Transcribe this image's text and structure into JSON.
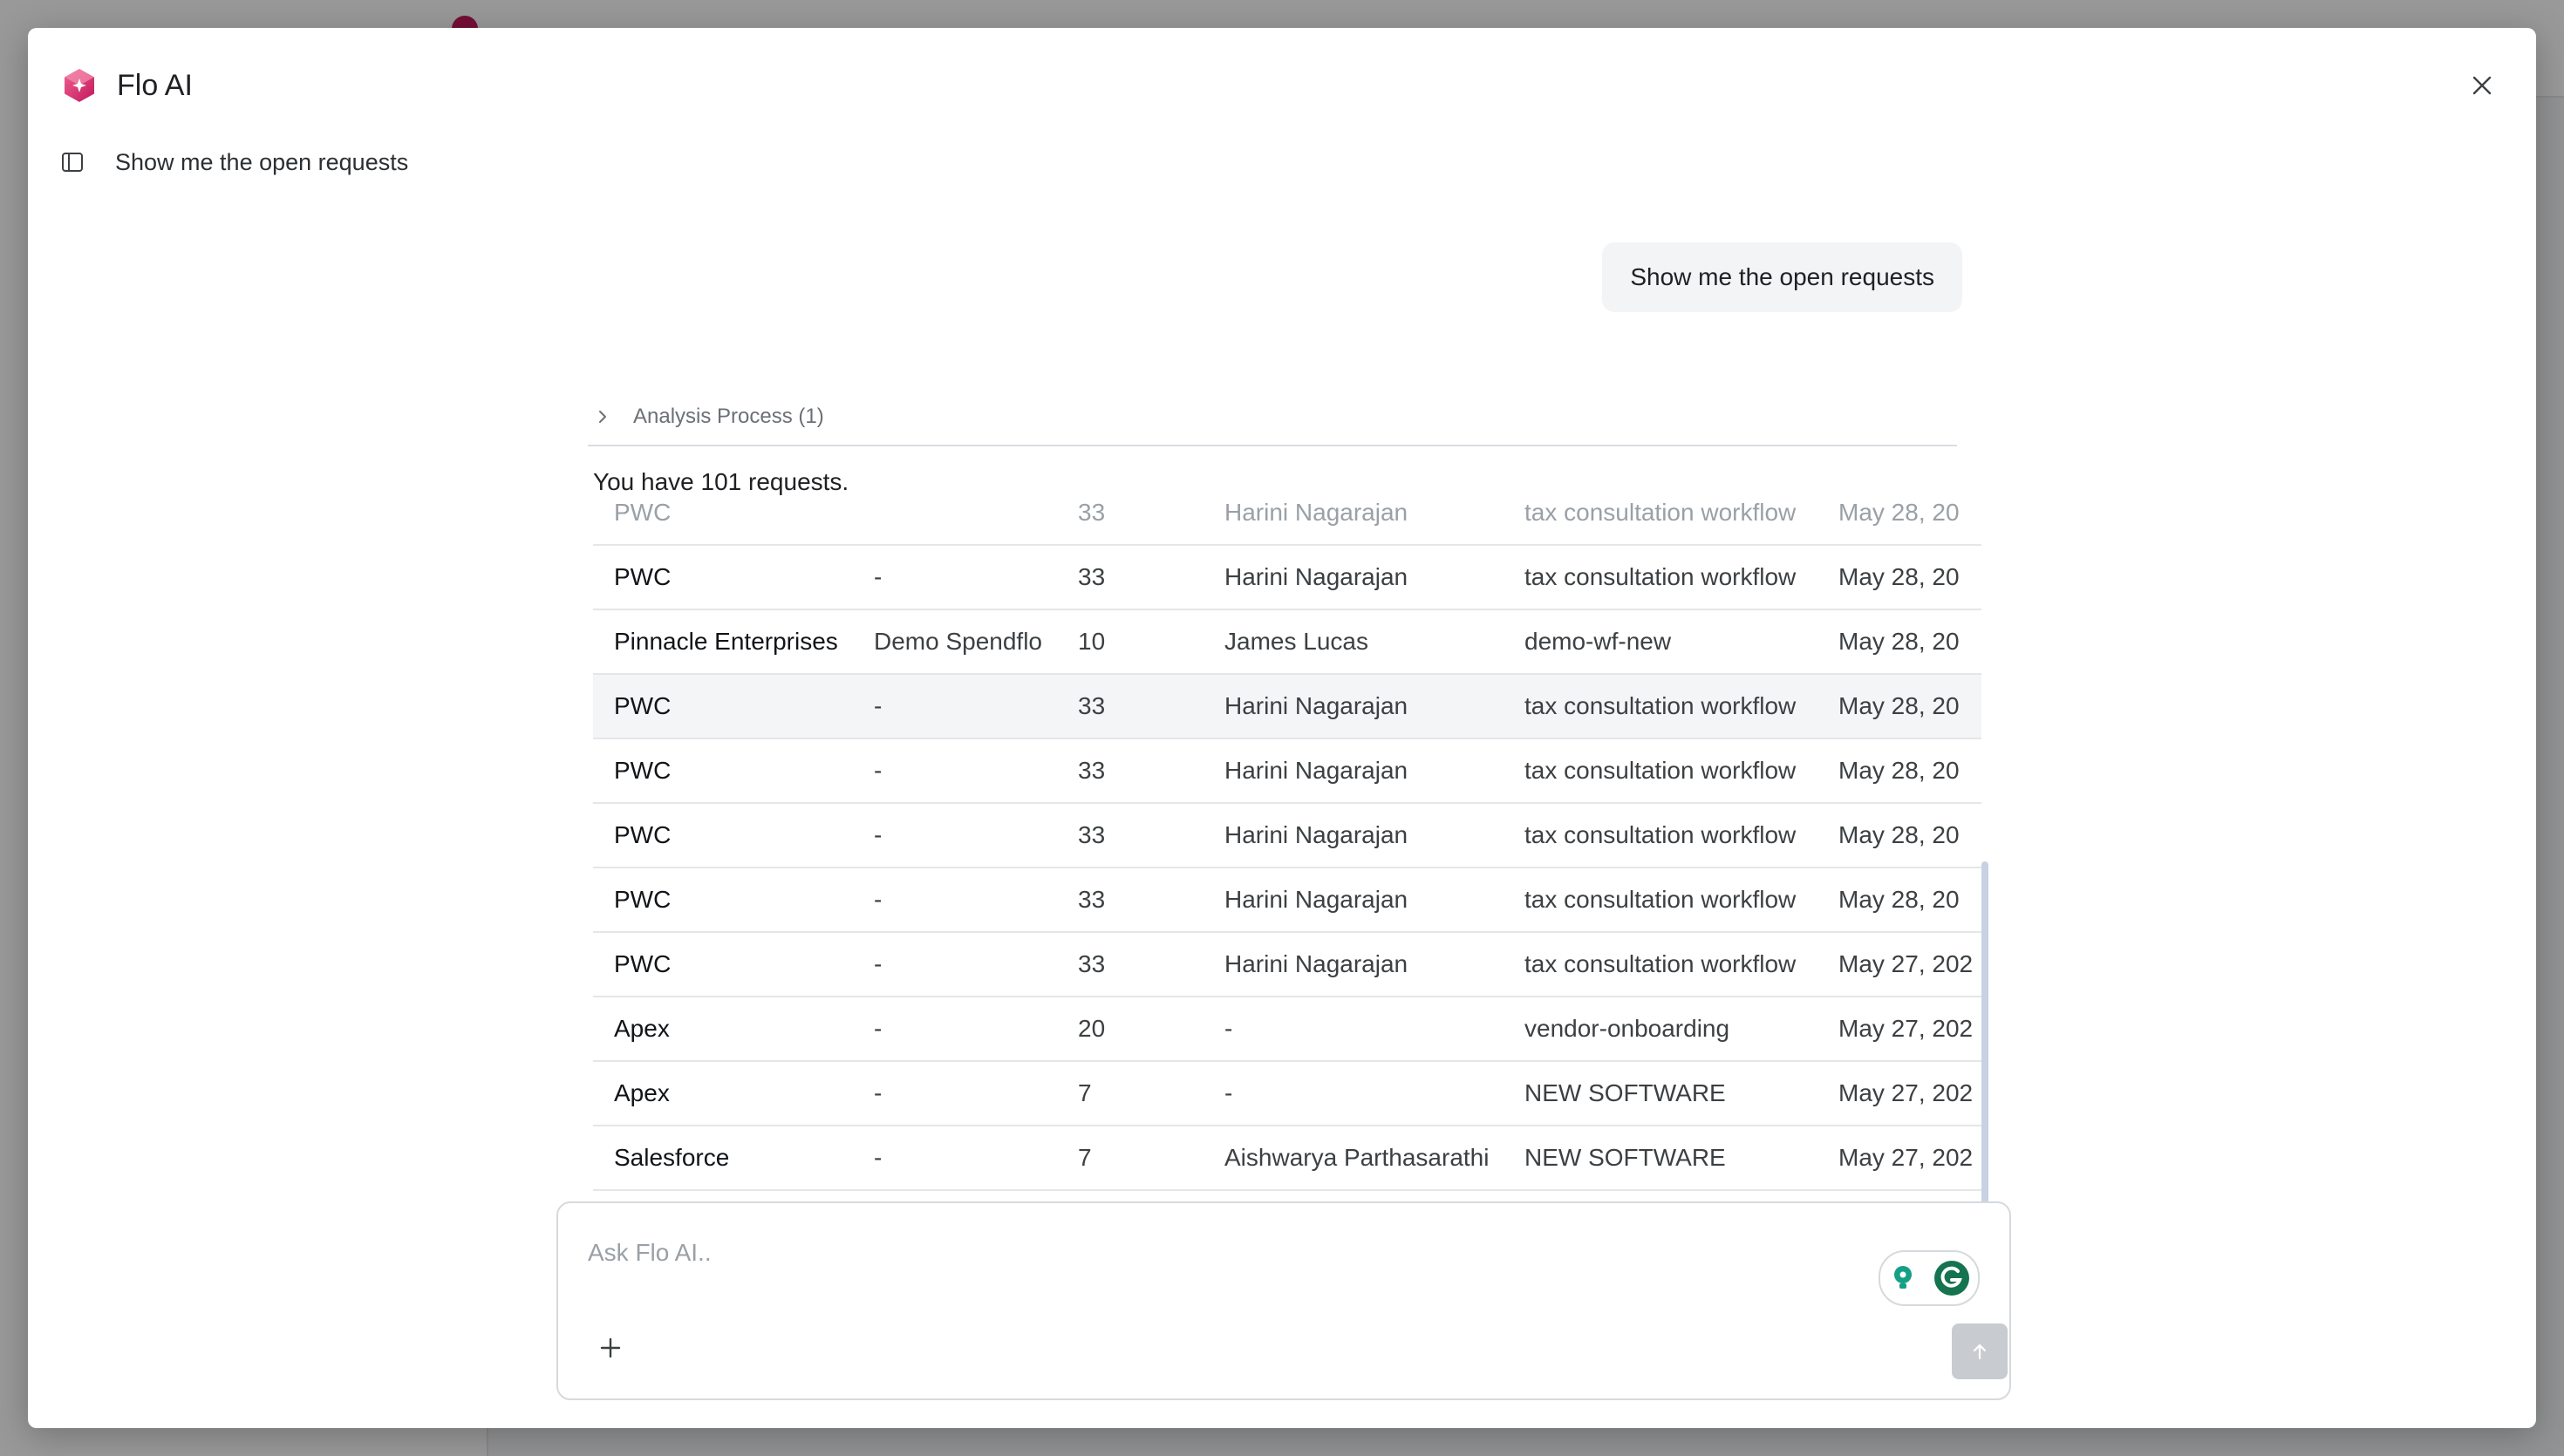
{
  "app": {
    "title": "Flo AI",
    "brand_color": "#d63384"
  },
  "conversation": {
    "title": "Show me the open requests"
  },
  "chat": {
    "user_message": "Show me the open requests",
    "analysis_label": "Analysis Process (1)",
    "summary": "You have 101 requests."
  },
  "table": {
    "partial_row": [
      "PWC",
      "",
      "33",
      "Harini Nagarajan",
      "tax consultation workflow",
      "May 28, 20"
    ],
    "rows": [
      [
        "PWC",
        "-",
        "33",
        "Harini Nagarajan",
        "tax consultation workflow",
        "May 28, 20"
      ],
      [
        "Pinnacle Enterprises",
        "Demo Spendflo",
        "10",
        "James Lucas",
        "demo-wf-new",
        "May 28, 20"
      ],
      [
        "PWC",
        "-",
        "33",
        "Harini Nagarajan",
        "tax consultation workflow",
        "May 28, 20"
      ],
      [
        "PWC",
        "-",
        "33",
        "Harini Nagarajan",
        "tax consultation workflow",
        "May 28, 20"
      ],
      [
        "PWC",
        "-",
        "33",
        "Harini Nagarajan",
        "tax consultation workflow",
        "May 28, 20"
      ],
      [
        "PWC",
        "-",
        "33",
        "Harini Nagarajan",
        "tax consultation workflow",
        "May 28, 20"
      ],
      [
        "PWC",
        "-",
        "33",
        "Harini Nagarajan",
        "tax consultation workflow",
        "May 27, 202"
      ],
      [
        "Apex",
        "-",
        "20",
        "-",
        "vendor-onboarding",
        "May 27, 202"
      ],
      [
        "Apex",
        "-",
        "7",
        "-",
        "NEW SOFTWARE",
        "May 27, 202"
      ],
      [
        "Salesforce",
        "-",
        "7",
        "Aishwarya Parthasarathi",
        "NEW SOFTWARE",
        "May 27, 202"
      ]
    ]
  },
  "composer": {
    "placeholder": "Ask Flo AI.."
  },
  "icons": {
    "logo": "flo-ai-logo",
    "close": "close-icon",
    "sidebar_toggle": "sidebar-panel-icon",
    "chevron": "chevron-right-icon",
    "plus": "plus-icon",
    "send": "arrow-up-icon",
    "extension": "grammarly-icon"
  }
}
